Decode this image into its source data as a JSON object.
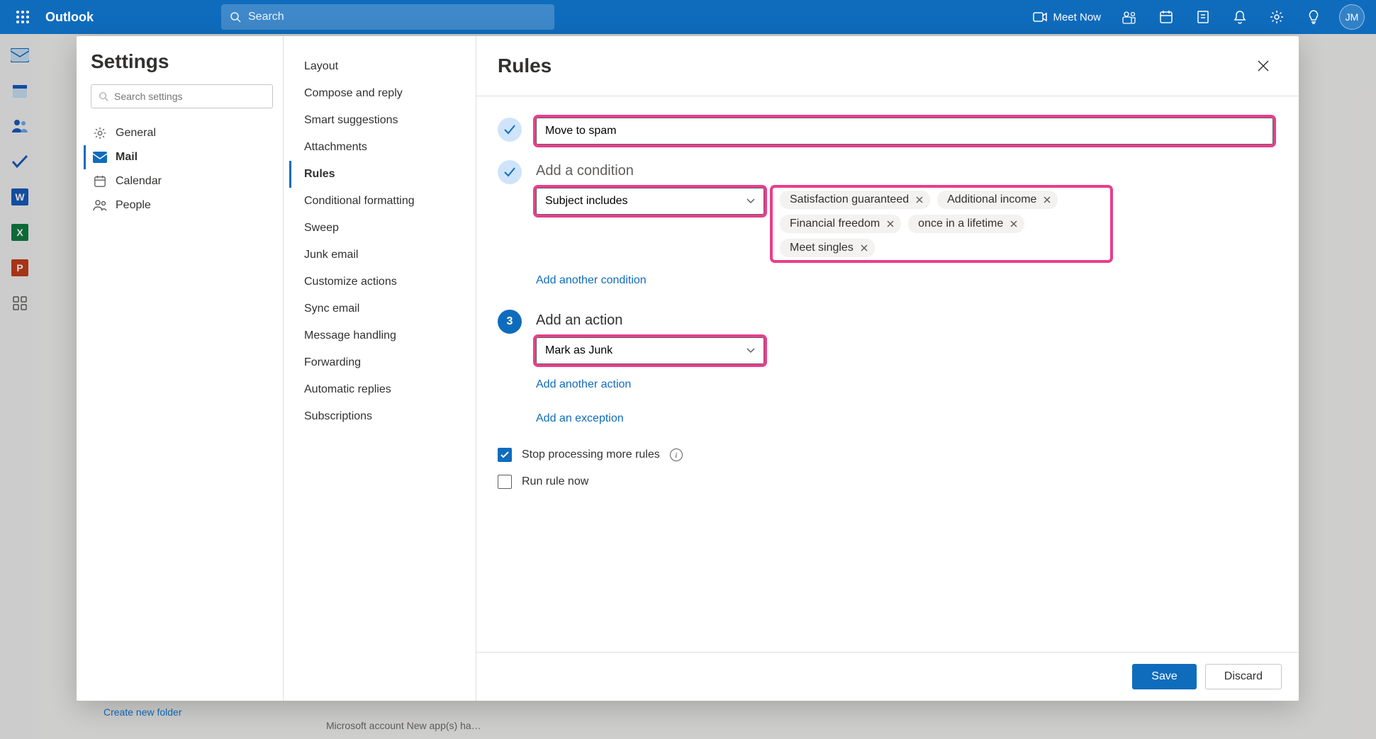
{
  "top": {
    "app_name": "Outlook",
    "search_placeholder": "Search",
    "meet_now": "Meet Now",
    "avatar": "JM"
  },
  "bg": {
    "create_folder": "Create new folder",
    "snippet_line2": "Microsoft account New app(s) ha…"
  },
  "modal": {
    "title": "Settings",
    "search_placeholder": "Search settings",
    "categories": [
      {
        "icon": "gear",
        "label": "General"
      },
      {
        "icon": "mail",
        "label": "Mail"
      },
      {
        "icon": "calendar",
        "label": "Calendar"
      },
      {
        "icon": "people",
        "label": "People"
      }
    ],
    "subcats": [
      "Layout",
      "Compose and reply",
      "Smart suggestions",
      "Attachments",
      "Rules",
      "Conditional formatting",
      "Sweep",
      "Junk email",
      "Customize actions",
      "Sync email",
      "Message handling",
      "Forwarding",
      "Automatic replies",
      "Subscriptions"
    ],
    "panel_title": "Rules",
    "rule_name": "Move to spam",
    "step2_title": "Add a condition",
    "condition_select": "Subject includes",
    "chips": [
      "Satisfaction guaranteed",
      "Additional income",
      "Financial freedom",
      "once in a lifetime",
      "Meet singles"
    ],
    "add_condition": "Add another condition",
    "step3_title": "Add an action",
    "step3_num": "3",
    "action_select": "Mark as Junk",
    "add_action": "Add another action",
    "add_exception": "Add an exception",
    "stop_processing": "Stop processing more rules",
    "run_now": "Run rule now",
    "save": "Save",
    "discard": "Discard"
  }
}
